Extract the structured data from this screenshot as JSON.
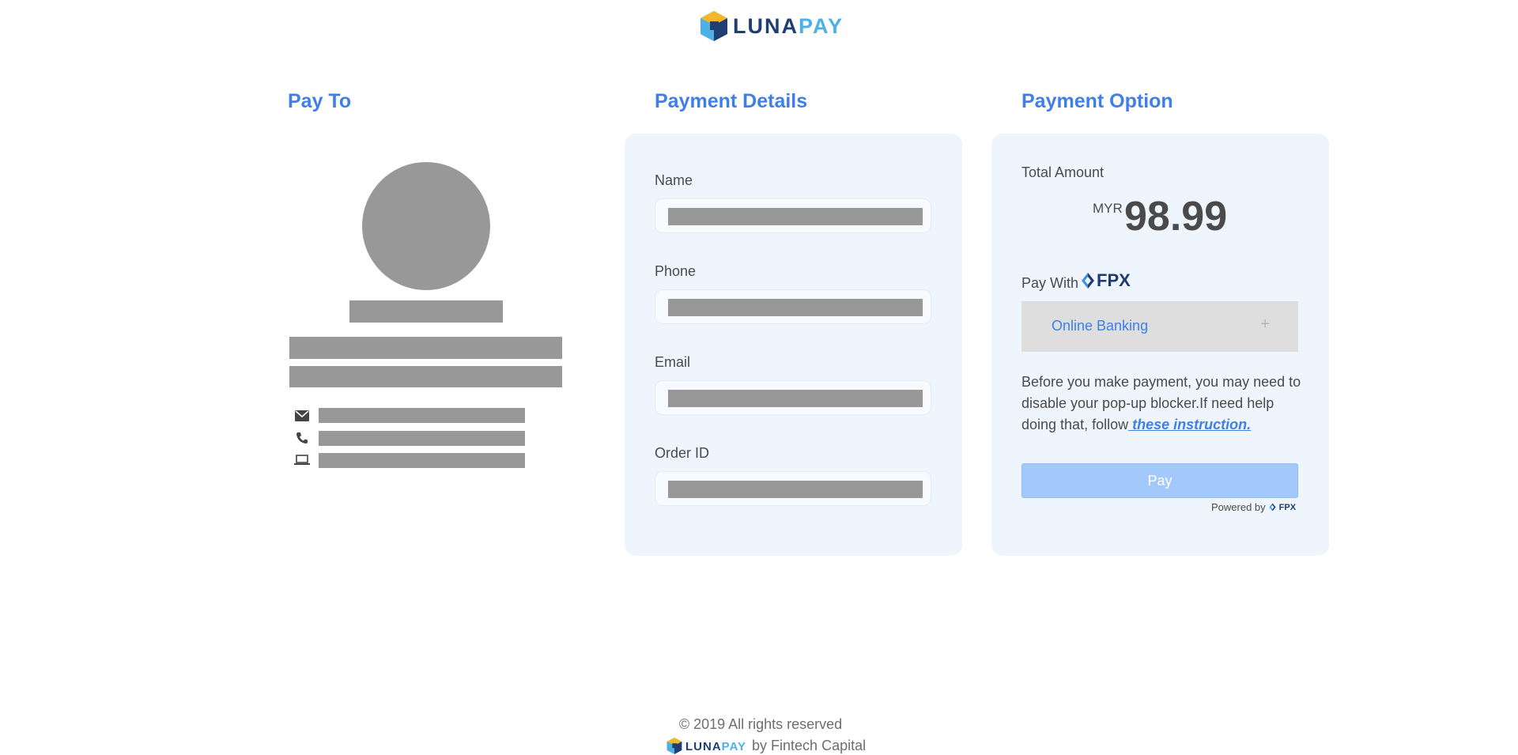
{
  "header": {
    "logo": {
      "icon": "lunapay-cube-logo",
      "text_luna": "LUNA",
      "text_pay": "PAY"
    }
  },
  "pay_to": {
    "title": "Pay To",
    "contacts": [
      {
        "icon": "envelope-icon"
      },
      {
        "icon": "phone-icon"
      },
      {
        "icon": "laptop-icon"
      }
    ]
  },
  "payment_details": {
    "title": "Payment Details",
    "fields": [
      {
        "label": "Name"
      },
      {
        "label": "Phone"
      },
      {
        "label": "Email"
      },
      {
        "label": "Order ID"
      }
    ]
  },
  "payment_option": {
    "title": "Payment Option",
    "total_label": "Total Amount",
    "currency": "MYR",
    "amount": "98.99",
    "pay_with_label": "Pay With",
    "fpx_logo_text": "FPX",
    "bank_select_label": "Online Banking",
    "bank_select_icon": "+",
    "notice_text": "Before you make payment, you may need to disable your pop-up blocker.If need help doing that, follow",
    "notice_link": " these instruction.",
    "pay_button": "Pay",
    "powered_by": "Powered by",
    "powered_logo_text": "FPX"
  },
  "footer": {
    "copyright": "© 2019 All rights reserved",
    "brand_luna": "LUNA",
    "brand_pay": "PAY",
    "brand_suffix": "by Fintech Capital"
  },
  "colors": {
    "accent": "#3f7fe6",
    "panel_bg": "#eef5fd",
    "redaction": "#989898",
    "button_disabled": "#a3c8fb"
  }
}
